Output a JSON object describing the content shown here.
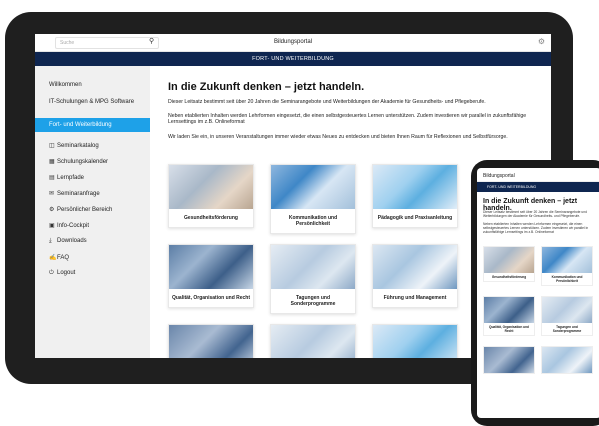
{
  "portal": {
    "title": "Bildungsportal",
    "search_placeholder": "Suche",
    "nav_band": "FORT- UND WEITERBILDUNG"
  },
  "sidebar": {
    "welcome": "Willkommen",
    "items": [
      {
        "label": "IT-Schulungen & MPG Software",
        "icon": "none"
      },
      {
        "label": "Fort- und Weiterbildung",
        "icon": "none",
        "active": true
      },
      {
        "label": "Seminarkatalog",
        "icon": "book-icon"
      },
      {
        "label": "Schulungskalender",
        "icon": "calendar-icon"
      },
      {
        "label": "Lernpfade",
        "icon": "path-icon"
      },
      {
        "label": "Seminaranfrage",
        "icon": "mail-icon"
      },
      {
        "label": "Persönlicher Bereich",
        "icon": "gear-icon"
      },
      {
        "label": "Info-Cockpit",
        "icon": "grid-icon"
      },
      {
        "label": "Downloads",
        "icon": "download-icon"
      },
      {
        "label": "FAQ",
        "icon": "chat-icon"
      },
      {
        "label": "Logout",
        "icon": "power-icon"
      }
    ]
  },
  "main": {
    "heading": "In die Zukunft denken – jetzt handeln.",
    "p1": "Dieser Leitsatz bestimmt seit über 20 Jahren die Seminarangebote und Weiterbildungen der Akademie für Gesundheits- und Pflegeberufe.",
    "p2": "Neben etablierten Inhalten werden Lehrformen eingesetzt, die einen selbstgesteuertes Lernen unterstützen. Zudem investieren wir parallel in zukunftsfähige Lernsettings im z.B. Onlineformat",
    "p3": "Wir laden Sie ein, in unseren Veranstaltungen immer wieder etwas Neues zu entdecken und bieten Ihnen Raum für Reflexionen und Selbstfürsorge.",
    "cards": [
      {
        "label": "Gesundheitsförderung"
      },
      {
        "label": "Kommunikation und Persönlichkeit"
      },
      {
        "label": "Pädagogik und Praxisanleitung"
      },
      {
        "label": "Qualität, Organisation und Recht"
      },
      {
        "label": "Tagungen und Sonderprogramme"
      },
      {
        "label": "Führung und Management"
      }
    ]
  },
  "phone": {
    "title": "Bildungsportal",
    "nav_band": "FORT- UND WEITERBILDUNG",
    "heading": "In die Zukunft denken – jetzt handeln.",
    "p1": "Dieser Leitsatz bestimmt seit über 20 Jahren die Seminarangebote und Weiterbildungen der Akademie für Gesundheits- und Pflegeberufe.",
    "p2": "Neben etablierten Inhalten werden Lehrformen eingesetzt, die einen selbstgesteuertes Lernen unterstützen. Zudem investieren wir parallel in zukunftsfähige Lernsettings im z.B. Onlineformat",
    "cards": [
      {
        "label": "Gesundheitsförderung"
      },
      {
        "label": "Kommunikation und Persönlichkeit"
      },
      {
        "label": "Qualität, Organisation und Recht"
      },
      {
        "label": "Tagungen und Sonderprogramme"
      }
    ]
  },
  "colors": {
    "nav_band": "#0f2650",
    "active_item": "#1ea1e8",
    "sidebar_bg": "#f0f0f0"
  }
}
